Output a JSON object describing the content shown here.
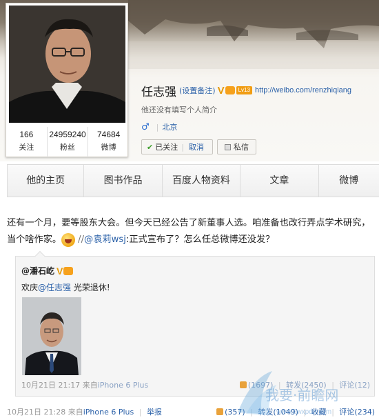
{
  "profile": {
    "name": "任志强",
    "remark_link": "(设置备注)",
    "verified_badge": "V",
    "level_badge": "Lv13",
    "url": "http://weibo.com/renzhiqiang",
    "bio": "他还没有填写个人简介",
    "gender_icon": "male-icon",
    "location": "北京",
    "stats": [
      {
        "value": "166",
        "label": "关注"
      },
      {
        "value": "24959240",
        "label": "粉丝"
      },
      {
        "value": "74684",
        "label": "微博"
      }
    ],
    "follow_state": "已关注",
    "unfollow_label": "取消",
    "message_label": "私信"
  },
  "tabs": [
    {
      "label": "他的主页"
    },
    {
      "label": "图书作品"
    },
    {
      "label": "百度人物资料"
    },
    {
      "label": "文章"
    },
    {
      "label": "微博"
    }
  ],
  "post": {
    "line1": "还有一个月，要等股东大会。但今天已经公告了新董事人选。咱准备也改行弄点学术研究，",
    "line2_prefix": "当个啥作家。",
    "slash": " //",
    "mention": "@袁莉wsj",
    "line2_suffix": ":正式宣布了？怎么任总微博还没发？",
    "time": "10月21日 21:28",
    "source_prefix": "来自",
    "source": "iPhone 6 Plus",
    "report": "举报",
    "likes": "(357)",
    "reposts": "转发(1049)",
    "favorite": "收藏",
    "comments": "评论(234)"
  },
  "repost": {
    "author": "@潘石屹",
    "verified_badge": "V",
    "text_prefix": "欢庆",
    "mention": "@任志强",
    "text_suffix": " 光荣退休!",
    "time": "10月21日 21:17",
    "source_prefix": "来自",
    "source": "iPhone 6 Plus",
    "likes": "(1697)",
    "reposts": "转发(2450)",
    "comments": "评论(12)"
  },
  "watermark": {
    "text": "我要·前瞻网",
    "url": "www.5wxpdn.com"
  },
  "colors": {
    "link": "#2a60a8",
    "verified": "#e59a08",
    "accent_orange": "#f19d13"
  }
}
